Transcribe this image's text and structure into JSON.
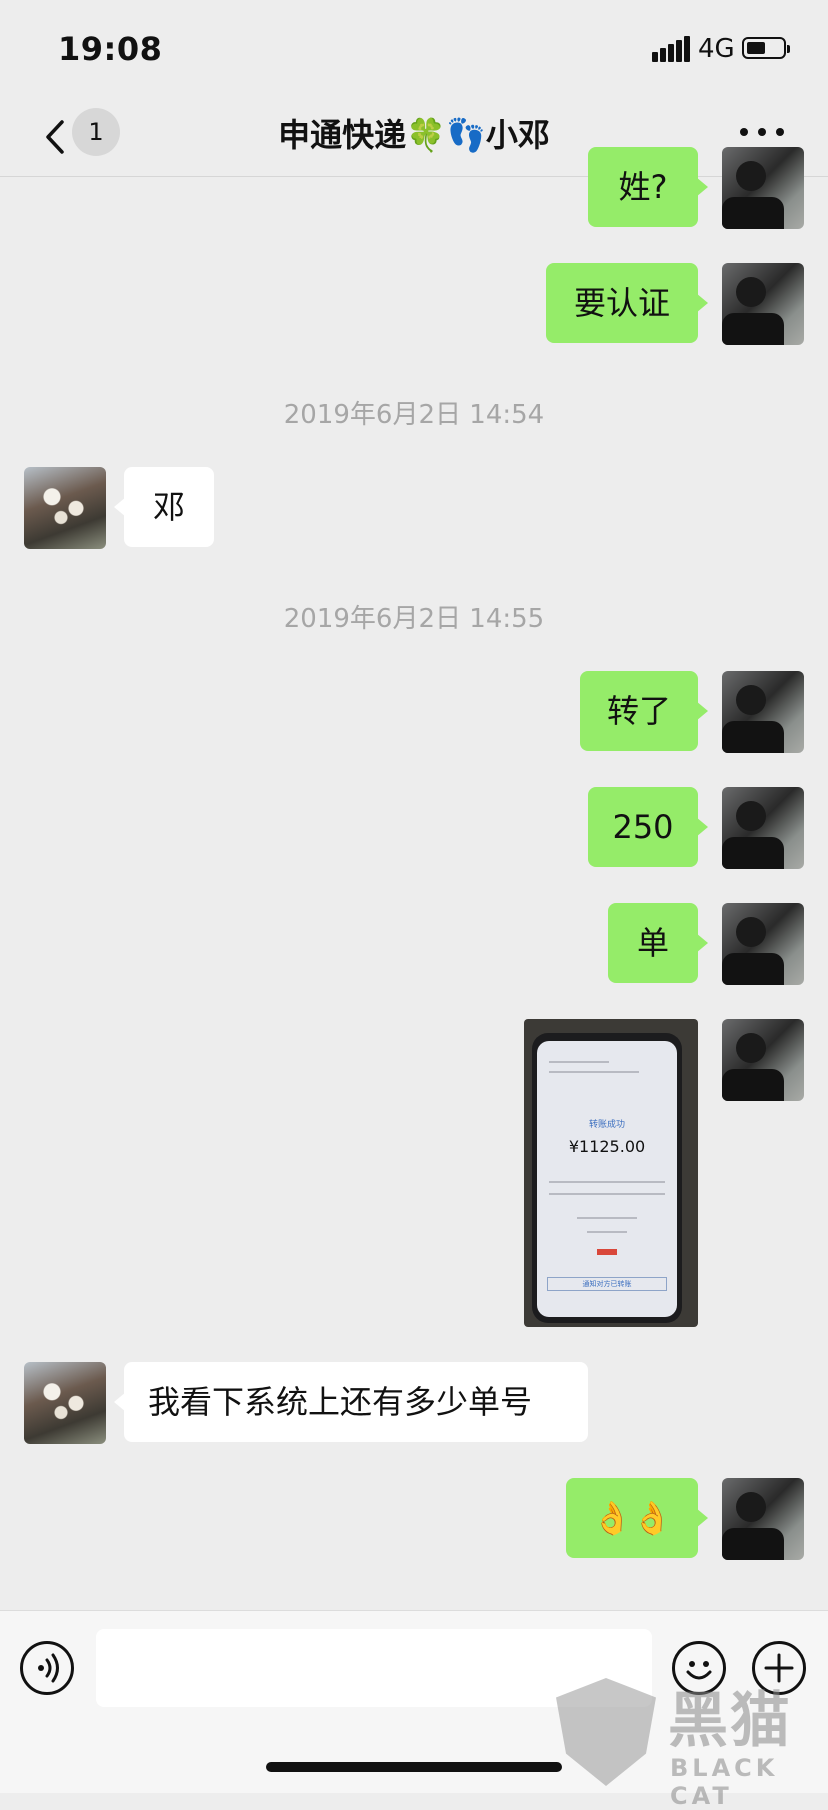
{
  "status_bar": {
    "time": "19:08",
    "network": "4G"
  },
  "nav": {
    "unread_count": "1",
    "title": "申通快递🍀👣小邓"
  },
  "messages": {
    "m1": "姓?",
    "m2": "要认证",
    "ts1": "2019年6月2日 14:54",
    "m3": "邓",
    "ts2": "2019年6月2日 14:55",
    "m4": "转了",
    "m5": "250",
    "m6": "单",
    "photo": {
      "status": "转账成功",
      "amount": "¥1125.00",
      "button": "通知对方已转账"
    },
    "m7": "我看下系统上还有多少单号",
    "m8": "👌👌"
  },
  "input": {
    "value": "",
    "placeholder": ""
  },
  "watermark": {
    "zh": "黑猫",
    "en": "BLACK CAT"
  }
}
